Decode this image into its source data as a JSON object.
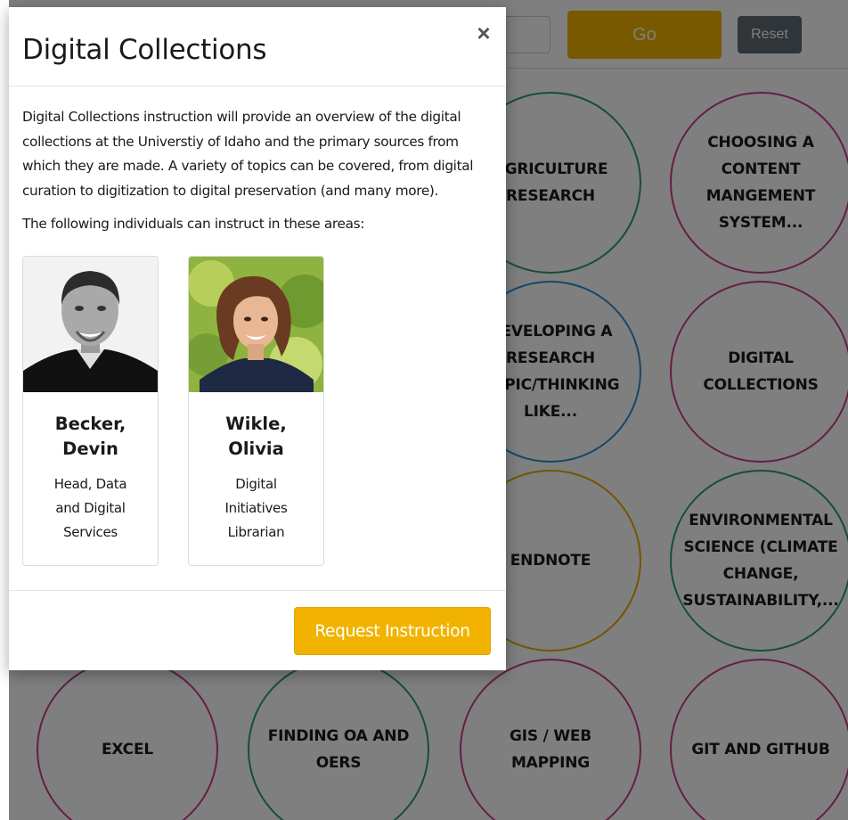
{
  "header": {
    "go_label": "Go",
    "reset_label": "Reset"
  },
  "topics": [
    {
      "label": "AGRICULTURE RESEARCH"
    },
    {
      "label": "CHOOSING A CONTENT MANGEMENT SYSTEM..."
    },
    {
      "label": "DEVELOPING A RESEARCH TOPIC/THINKING LIKE..."
    },
    {
      "label": "DIGITAL COLLECTIONS"
    },
    {
      "label": "ENDNOTE"
    },
    {
      "label": "ENVIRONMENTAL SCIENCE (CLIMATE CHANGE, SUSTAINABILITY,..."
    },
    {
      "label": "EXCEL"
    },
    {
      "label": "FINDING OA AND OERS"
    },
    {
      "label": "GIS / WEB MAPPING"
    },
    {
      "label": "GIT AND GITHUB"
    }
  ],
  "modal": {
    "title": "Digital Collections",
    "close_symbol": "×",
    "description": "Digital Collections instruction will provide an overview of the digital collections at the Universtiy of Idaho and the primary sources from which they are made. A variety of topics can be covered, from digital curation to digitization to digital preservation (and many more).",
    "subheading": "The following individuals can instruct in these areas:",
    "instructors": [
      {
        "name": "Becker, Devin",
        "role": "Head, Data and Digital Services"
      },
      {
        "name": "Wikle, Olivia",
        "role": "Digital Initiatives Librarian"
      }
    ],
    "request_label": "Request Instruction"
  },
  "colors": {
    "accent_gold": "#f1b300",
    "reset_gray": "#5f6a72",
    "circle_green": "#2a9d6a",
    "circle_pink": "#c93c8f",
    "circle_blue": "#2c8fd0",
    "circle_gold": "#e6a800"
  }
}
